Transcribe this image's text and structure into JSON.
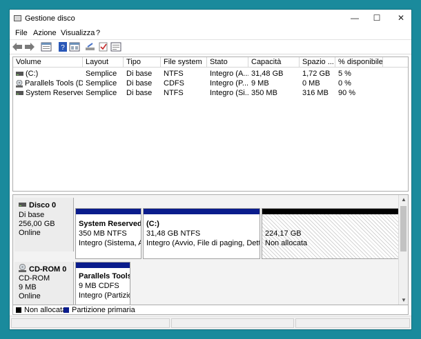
{
  "window": {
    "title": "Gestione disco",
    "minimize": "—",
    "maximize": "☐",
    "close": "✕"
  },
  "menu": [
    "File",
    "Azione",
    "Visualizza",
    "?"
  ],
  "toolbar": {
    "icons": [
      "back-arrow-icon",
      "forward-arrow-icon",
      "disk-list-icon",
      "help-icon",
      "properties-icon",
      "connect-drive-icon",
      "checklist-icon",
      "settings-icon"
    ]
  },
  "volumes": {
    "columns": [
      "Volume",
      "Layout",
      "Tipo",
      "File system",
      "Stato",
      "Capacità",
      "Spazio ...",
      "% disponibile"
    ],
    "rows": [
      [
        "(C:)",
        "Semplice",
        "Di base",
        "NTFS",
        "Integro (A...",
        "31,48 GB",
        "1,72 GB",
        "5 %"
      ],
      [
        "Parallels Tools (D:)",
        "Semplice",
        "Di base",
        "CDFS",
        "Integro (P...",
        "9 MB",
        "0 MB",
        "0 %"
      ],
      [
        "System Reserved",
        "Semplice",
        "Di base",
        "NTFS",
        "Integro (Si...",
        "350 MB",
        "316 MB",
        "90 %"
      ]
    ]
  },
  "disks": [
    {
      "name": "Disco 0",
      "type": "Di base",
      "size": "256,00 GB",
      "status": "Online",
      "partitions": [
        {
          "title": "System Reserved",
          "size": "350 MB NTFS",
          "status": "Integro (Sistema, Att"
        },
        {
          "title": "(C:)",
          "size": "31,48 GB NTFS",
          "status": "Integro (Avvio, File di paging, Dettagli"
        },
        {
          "title": "",
          "size": "224,17 GB",
          "status": "Non allocata"
        }
      ]
    },
    {
      "name": "CD-ROM 0",
      "type": "CD-ROM",
      "size": "9 MB",
      "status": "Online",
      "partitions": [
        {
          "title": "Parallels Tools",
          "size": "9 MB CDFS",
          "status": "Integro (Partizion"
        }
      ]
    }
  ],
  "legend": [
    {
      "label": "Non allocata",
      "color": "#000000"
    },
    {
      "label": "Partizione primaria",
      "color": "#0a1c8c"
    }
  ],
  "colors": {
    "primary_partition": "#0a1c8c",
    "unallocated": "#000000",
    "desktop": "#1a8a9c"
  }
}
